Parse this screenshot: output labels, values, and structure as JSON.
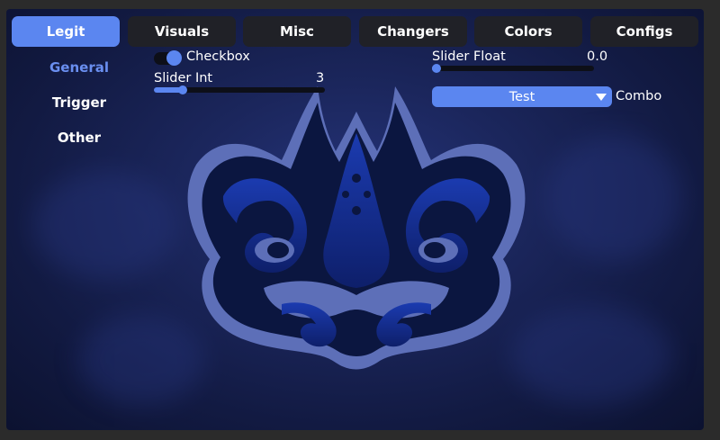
{
  "tabs": [
    {
      "label": "Legit",
      "active": true
    },
    {
      "label": "Visuals",
      "active": false
    },
    {
      "label": "Misc",
      "active": false
    },
    {
      "label": "Changers",
      "active": false
    },
    {
      "label": "Colors",
      "active": false
    },
    {
      "label": "Configs",
      "active": false
    }
  ],
  "subnav": [
    {
      "label": "General",
      "active": true
    },
    {
      "label": "Trigger",
      "active": false
    },
    {
      "label": "Other",
      "active": false
    }
  ],
  "checkbox": {
    "label": "Checkbox",
    "checked": true
  },
  "slider_int": {
    "label": "Slider Int",
    "value": "3",
    "fraction": 0.15
  },
  "slider_float": {
    "label": "Slider Float",
    "value": "0.0",
    "fraction": 0.0
  },
  "combo": {
    "value": "Test",
    "label": "Combo"
  },
  "colors": {
    "accent": "#5b86f0",
    "tab_bg": "#202127",
    "bg": "#1b265c"
  },
  "logo": {
    "icon": "kraken-logo-icon"
  }
}
